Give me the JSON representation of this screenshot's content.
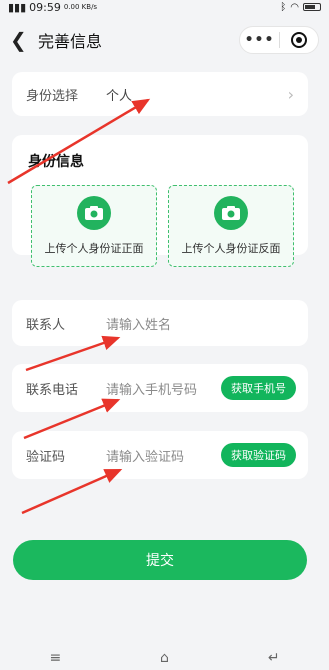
{
  "status": {
    "time": "09:59",
    "net": "0.00 KB/s"
  },
  "nav": {
    "title": "完善信息",
    "back_icon": "back-arrow-icon",
    "more_label": "•••"
  },
  "identity_select": {
    "label": "身份选择",
    "value": "个人"
  },
  "identity_info": {
    "title": "身份信息",
    "front_caption": "上传个人身份证正面",
    "back_caption": "上传个人身份证反面"
  },
  "form": {
    "name_label": "联系人",
    "name_placeholder": "请输入姓名",
    "phone_label": "联系电话",
    "phone_placeholder": "请输入手机号码",
    "phone_button": "获取手机号",
    "code_label": "验证码",
    "code_placeholder": "请输入验证码",
    "code_button": "获取验证码"
  },
  "submit_label": "提交",
  "colors": {
    "accent": "#1bb85e",
    "arrow": "#e8352b"
  }
}
